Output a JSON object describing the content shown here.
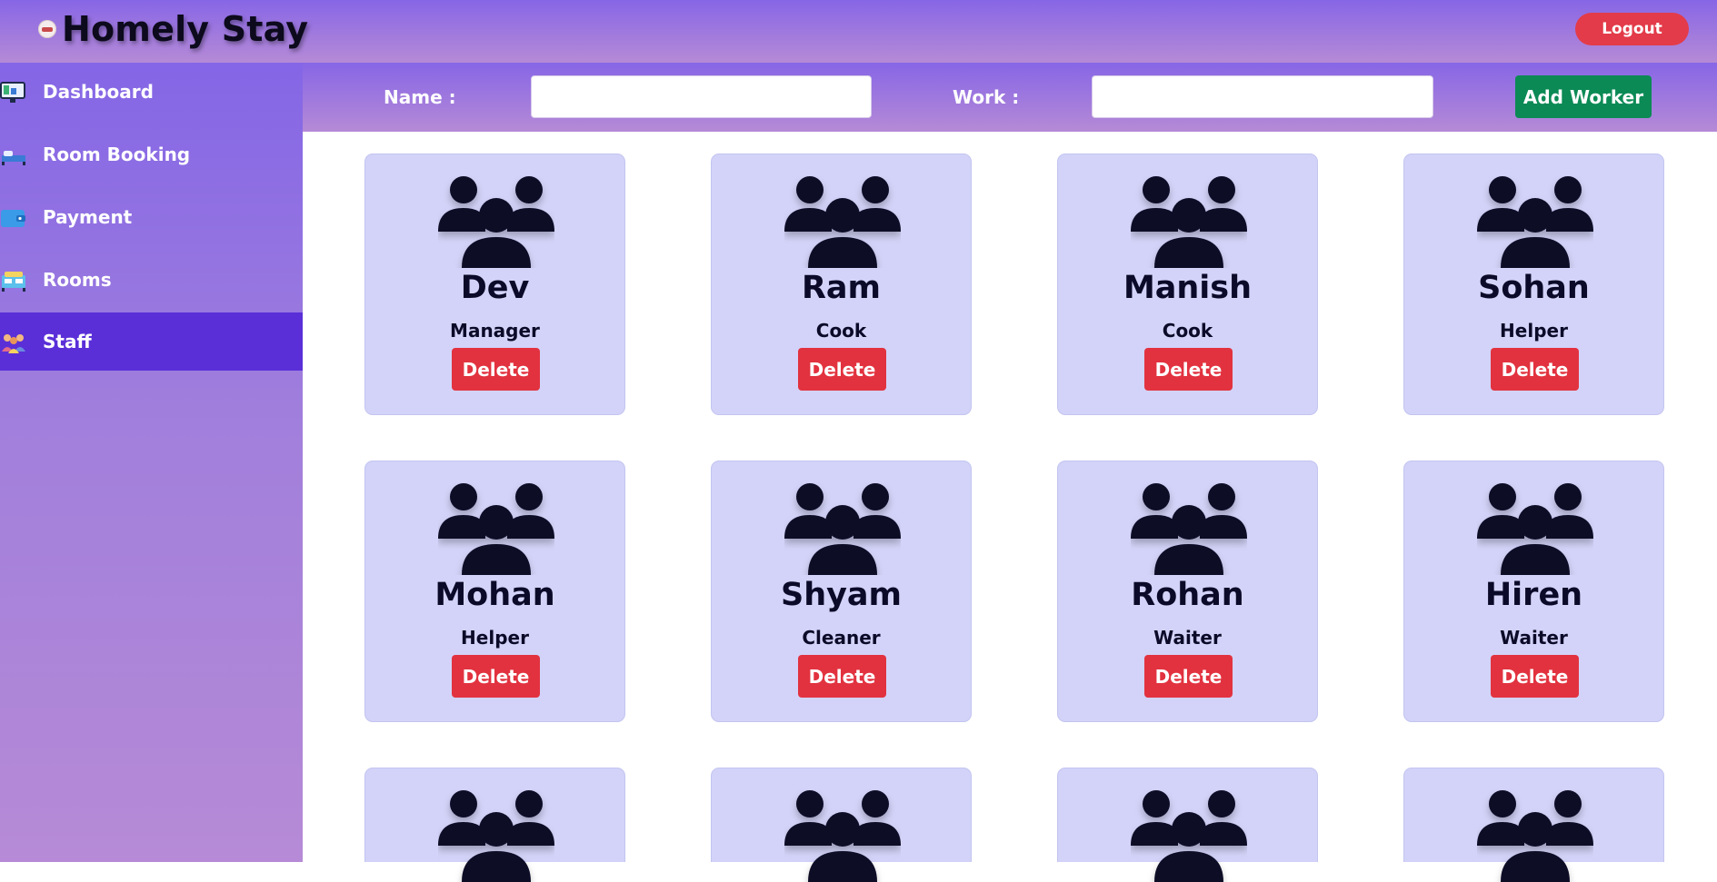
{
  "header": {
    "brand": "Homely Stay",
    "logout_label": "Logout"
  },
  "sidebar": {
    "items": [
      {
        "label": "Dashboard",
        "icon": "dashboard-icon"
      },
      {
        "label": "Room Booking",
        "icon": "room-booking-icon"
      },
      {
        "label": "Payment",
        "icon": "wallet-icon"
      },
      {
        "label": "Rooms",
        "icon": "rooms-icon"
      },
      {
        "label": "Staff",
        "icon": "staff-icon",
        "active": true
      }
    ]
  },
  "form": {
    "name_label": "Name :",
    "name_value": "",
    "work_label": "Work :",
    "work_value": "",
    "add_label": "Add Worker"
  },
  "workers": [
    {
      "name": "Dev",
      "role": "Manager",
      "delete_label": "Delete"
    },
    {
      "name": "Ram",
      "role": "Cook",
      "delete_label": "Delete"
    },
    {
      "name": "Manish",
      "role": "Cook",
      "delete_label": "Delete"
    },
    {
      "name": "Sohan",
      "role": "Helper",
      "delete_label": "Delete"
    },
    {
      "name": "Mohan",
      "role": "Helper",
      "delete_label": "Delete"
    },
    {
      "name": "Shyam",
      "role": "Cleaner",
      "delete_label": "Delete"
    },
    {
      "name": "Rohan",
      "role": "Waiter",
      "delete_label": "Delete"
    },
    {
      "name": "Hiren",
      "role": "Waiter",
      "delete_label": "Delete"
    }
  ],
  "colors": {
    "header_gradient_top": "#8766e6",
    "header_gradient_bottom": "#b58ad6",
    "active_nav": "#5a2fd8",
    "card_bg": "#d3d3f9",
    "delete_red": "#e2323f",
    "logout_red": "#e33b49",
    "add_green": "#0b8a55",
    "icon_dark": "#0c0a28"
  }
}
